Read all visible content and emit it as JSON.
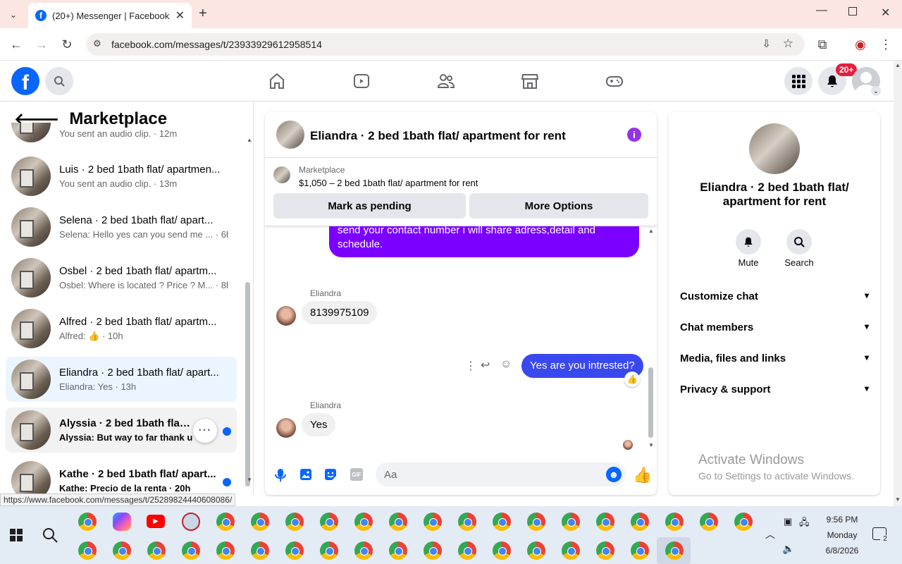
{
  "browser": {
    "tab_title": "(20+) Messenger | Facebook",
    "url": "facebook.com/messages/t/23933929612958514",
    "status_url": "https://www.facebook.com/messages/t/25289824440608086/"
  },
  "fb": {
    "notif_badge": "20+"
  },
  "sidebar": {
    "title": "Marketplace",
    "partial_top": "You sent an audio clip. · 12m",
    "conversations": [
      {
        "name": "Luis · 2 bed 1bath flat/ apartmen...",
        "snippet": "You sent an audio clip. · 13m",
        "unread": false,
        "active": false
      },
      {
        "name": "Selena · 2 bed 1bath flat/ apart...",
        "snippet": "Selena: Hello yes can you send me ... · 6h",
        "unread": false,
        "active": false
      },
      {
        "name": "Osbel · 2 bed 1bath flat/ apartm...",
        "snippet": "Osbel: Where is located ? Price ? M... · 8h",
        "unread": false,
        "active": false
      },
      {
        "name": "Alfred · 2 bed 1bath flat/ apartm...",
        "snippet": "Alfred: 👍 · 10h",
        "unread": false,
        "active": false
      },
      {
        "name": "Eliandra · 2 bed 1bath flat/ apart...",
        "snippet": "Eliandra: Yes · 13h",
        "unread": false,
        "active": true
      },
      {
        "name": "Alyssia · 2 bed 1bath flat/ apartm...",
        "snippet": "Alyssia: But way to far thank u ... · 1d",
        "unread": true,
        "active": false
      },
      {
        "name": "Kathe · 2 bed 1bath flat/ apart...",
        "snippet": "Kathe: Precio de la renta · 20h",
        "unread": true,
        "active": false
      }
    ]
  },
  "chat": {
    "title": "Eliandra · 2 bed 1bath flat/ apartment for rent",
    "listing_source": "Marketplace",
    "listing_text": "$1,050 – 2 bed 1bath flat/ apartment for rent",
    "mark_pending": "Mark as pending",
    "more_options": "More Options",
    "msg_sent_1": "send your contact number i will share adress,detail and schedule.",
    "sender_name_1": "Eliandra",
    "msg_recv_1": "8139975109",
    "msg_sent_2": "Yes are you intrested?",
    "sender_name_2": "Eliandra",
    "msg_recv_2": "Yes",
    "input_placeholder": "Aa"
  },
  "info": {
    "title": "Eliandra · 2 bed 1bath flat/ apartment for rent",
    "mute": "Mute",
    "search": "Search",
    "rows": [
      "Customize chat",
      "Chat members",
      "Media, files and links",
      "Privacy & support"
    ]
  },
  "watermark": {
    "line1": "Activate Windows",
    "line2": "Go to Settings to activate Windows."
  },
  "tray": {
    "time": "9:56 PM",
    "day": "Monday",
    "date": "6/8/2026",
    "notif": "2"
  }
}
